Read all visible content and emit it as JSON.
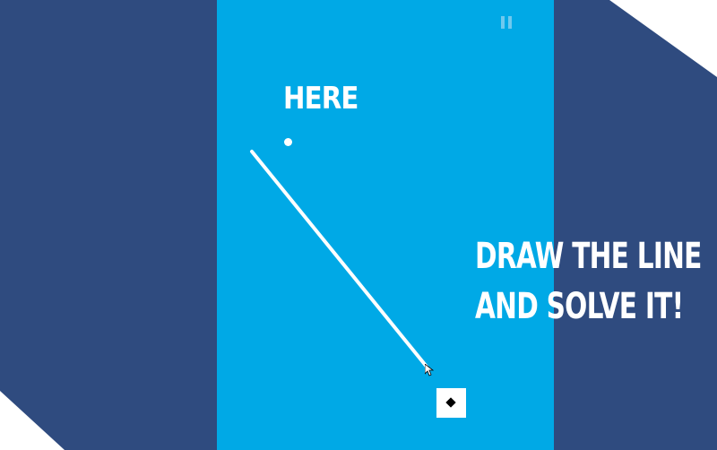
{
  "game": {
    "target_label": "HERE",
    "instruction_line1": "DRAW THE LINE",
    "instruction_line2": "AND SOLVE IT!"
  },
  "controls": {
    "pause_icon": "pause-icon"
  },
  "colors": {
    "background": "#2f4b7f",
    "play_area": "#00a9e6",
    "line": "#ffffff",
    "pause": "#6fc9ee",
    "goal_diamond": "#000000"
  },
  "icons": {
    "goal": "diamond-icon",
    "cursor": "mouse-pointer-icon"
  }
}
